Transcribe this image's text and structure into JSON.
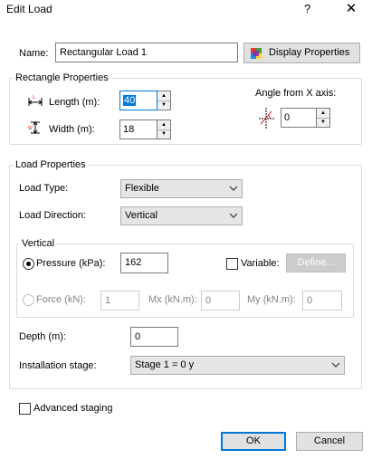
{
  "window": {
    "title": "Edit Load",
    "help_glyph": "?",
    "close_glyph": "✕"
  },
  "name": {
    "label": "Name:",
    "value": "Rectangular Load 1",
    "display_properties_label": "Display Properties"
  },
  "rectangle": {
    "group_label": "Rectangle Properties",
    "length_label": "Length (m):",
    "length_value": "40",
    "width_label": "Width (m):",
    "width_value": "18",
    "angle_label": "Angle from X axis:",
    "angle_value": "0"
  },
  "load": {
    "group_label": "Load Properties",
    "load_type_label": "Load Type:",
    "load_type_value": "Flexible",
    "load_direction_label": "Load Direction:",
    "load_direction_value": "Vertical",
    "vertical_group_label": "Vertical",
    "pressure_label": "Pressure (kPa):",
    "pressure_value": "162",
    "variable_label": "Variable:",
    "define_label": "Define...",
    "force_label": "Force (kN):",
    "force_value": "1",
    "mx_label": "Mx (kN.m):",
    "mx_value": "0",
    "my_label": "My (kN.m):",
    "my_value": "0",
    "depth_label": "Depth (m):",
    "depth_value": "0",
    "installation_label": "Installation stage:",
    "installation_value": "Stage 1 = 0 y"
  },
  "advanced_staging_label": "Advanced staging",
  "buttons": {
    "ok": "OK",
    "cancel": "Cancel"
  },
  "colors": {
    "focus_blue": "#0078d7",
    "length_icon_red": "#e02020",
    "angle_icon_red": "#e02020"
  }
}
